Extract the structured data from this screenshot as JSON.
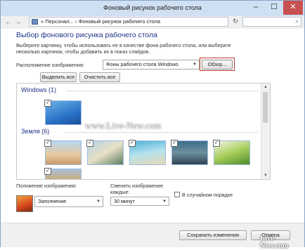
{
  "window": {
    "title": "Фоновый рисунок рабочего стола",
    "minimize": "–",
    "maximize": "☐",
    "close": "✕"
  },
  "address": {
    "back": "←",
    "forward": "→",
    "breadcrumb": "« Персонал... › Фоновый рисунок рабочего стола",
    "refresh": "↻",
    "search_icon": "⌕"
  },
  "main": {
    "heading": "Выбор фонового рисунка рабочего стола",
    "description": "Выберите картинку, чтобы использовать ее в качестве фона рабочего стола, или выберите несколько картинок, чтобы добавить их в показ слайдов.",
    "location_label": "Расположение изображения:",
    "location_value": "Фоны рабочего стола Windows",
    "browse_button": "Обзор...",
    "select_all_button": "Выделить все",
    "clear_all_button": "Очистить все"
  },
  "gallery": {
    "groups": [
      {
        "name": "Windows (1)",
        "count": 1
      },
      {
        "name": "Земля (6)",
        "count": 6
      }
    ],
    "watermark": "www.Live-New.com",
    "checked": [
      true,
      true,
      true,
      true,
      true,
      true,
      true
    ]
  },
  "options": {
    "position_label": "Положение изображения:",
    "position_value": "Заполнение",
    "interval_label": "Сменять изображение каждые:",
    "interval_value": "30 минут",
    "shuffle_label": "В случайном порядке",
    "shuffle_checked": false
  },
  "footer": {
    "save_button": "Сохранить изменения",
    "cancel_button": "Отмена",
    "site_logo": "Live-New.com"
  },
  "colors": {
    "accent_heading": "#1e3287",
    "highlight_border": "#c0392b"
  },
  "icons": {
    "dropdown": "chevron-down-icon",
    "checkbox": "checkmark-icon"
  }
}
